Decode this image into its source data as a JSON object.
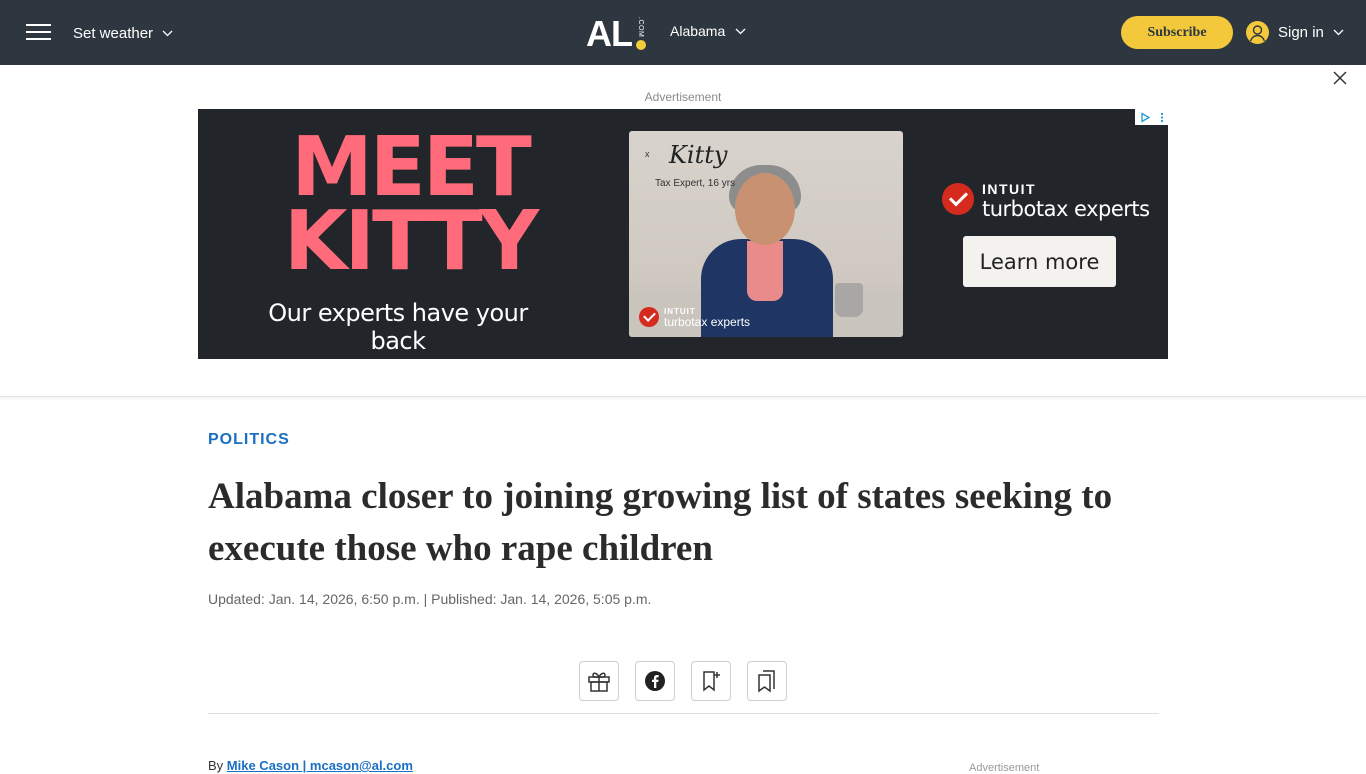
{
  "header": {
    "weather_label": "Set weather",
    "logo_text": "AL",
    "logo_suffix": ".COM",
    "region_label": "Alabama",
    "subscribe_label": "Subscribe",
    "signin_label": "Sign in",
    "bg_color": "#2e3740",
    "accent_color": "#f3c93b"
  },
  "ad": {
    "label": "Advertisement",
    "headline_line1": "MEET",
    "headline_line2": "KITTY",
    "tagline": "Our experts have your back",
    "signature_x": "x",
    "signature_name": "Kitty",
    "signature_title": "Tax Expert, 16 yrs",
    "brand_intuit": "INTUIT",
    "brand_product": "turbotax experts",
    "cta_label": "Learn more",
    "headline_color": "#ff6b7a",
    "bg_color": "#22262a"
  },
  "article": {
    "section": "POLITICS",
    "headline": "Alabama closer to joining growing list of states seeking to execute those who rape children",
    "dateline": "Updated: Jan. 14, 2026, 6:50 p.m. | Published: Jan. 14, 2026, 5:05 p.m.",
    "byline_prefix": "By",
    "author": "Mike Cason | mcason@al.com",
    "side_ad_label": "Advertisement",
    "section_color": "#1a6fc4"
  },
  "share_buttons": [
    {
      "icon": "gift-icon"
    },
    {
      "icon": "facebook-icon"
    },
    {
      "icon": "bookmark-add-icon"
    },
    {
      "icon": "saved-bookmarks-icon"
    }
  ]
}
